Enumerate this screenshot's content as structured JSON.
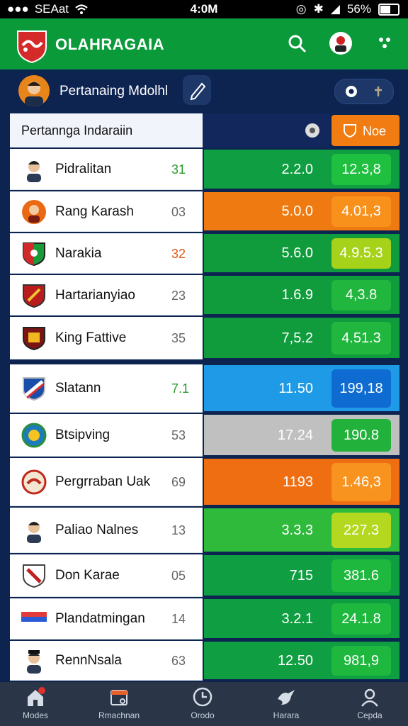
{
  "status": {
    "carrier": "SEAat",
    "time": "4:0M",
    "battery": "56%"
  },
  "app": {
    "title": "OLAHRAGAIA"
  },
  "subheader": {
    "title": "Pertanaing Mdolhl"
  },
  "table": {
    "header_label": "Pertannga Indaraiin",
    "header_button": "Noe",
    "rows": [
      {
        "name": "Pidralitan",
        "num": "31",
        "num_color": "#2a9a2a",
        "val": "2.2.0",
        "box": "12.3,8",
        "bar": "#0f9e41",
        "box_color": "#1fbf40",
        "badge": "face"
      },
      {
        "name": "Rang Karash",
        "num": "03",
        "num_color": "#666666",
        "val": "5.0.0",
        "box": "4.01,3",
        "bar": "#f07a12",
        "box_color": "#f8911c",
        "badge": "face-orange"
      },
      {
        "name": "Narakia",
        "num": "32",
        "num_color": "#e05a1a",
        "val": "5.6.0",
        "box": "4.9.5.3",
        "bar": "#109c3c",
        "box_color": "#a6d21a",
        "badge": "shield-green"
      },
      {
        "name": "Hartarianyiao",
        "num": "23",
        "num_color": "#666666",
        "val": "1.6.9",
        "box": "4,3.8",
        "bar": "#109c3c",
        "box_color": "#21b63d",
        "badge": "shield-red"
      },
      {
        "name": "King Fattive",
        "num": "35",
        "num_color": "#666666",
        "val": "7,5.2",
        "box": "4.51.3",
        "bar": "#109c3c",
        "box_color": "#21b63d",
        "badge": "shield-dark"
      },
      {
        "name": "Slatann",
        "num": "7.1",
        "num_color": "#2a9a2a",
        "val": "11.50",
        "box": "199,18",
        "bar": "#1e9ae6",
        "box_color": "#0d6bd2",
        "badge": "shield-blue"
      },
      {
        "name": "Btsipving",
        "num": "53",
        "num_color": "#666666",
        "val": "17.24",
        "box": "190.8",
        "bar": "#c0c0c0",
        "box_color": "#22b23c",
        "badge": "round-green"
      },
      {
        "name": "Pergrraban Uak",
        "num": "69",
        "num_color": "#666666",
        "val": "1193",
        "box": "1.46,3",
        "bar": "#ef6e12",
        "box_color": "#f7931e",
        "badge": "round-red"
      },
      {
        "name": "Paliao Nalnes",
        "num": "13",
        "num_color": "#666666",
        "val": "3.3.3",
        "box": "227.3",
        "bar": "#2fba3c",
        "box_color": "#b4d820",
        "badge": "face"
      },
      {
        "name": "Don Karae",
        "num": "05",
        "num_color": "#666666",
        "val": "715",
        "box": "381.6",
        "bar": "#0f9e41",
        "box_color": "#1fb83e",
        "badge": "shield-white"
      },
      {
        "name": "Plandatmingan",
        "num": "14",
        "num_color": "#666666",
        "val": "3.2.1",
        "box": "24.1.8",
        "bar": "#0f9e41",
        "box_color": "#1fb83e",
        "badge": "flag"
      },
      {
        "name": "RennNsala",
        "num": "63",
        "num_color": "#666666",
        "val": "12.50",
        "box": "981,9",
        "bar": "#0f9e41",
        "box_color": "#1fb83e",
        "badge": "face-cap"
      }
    ]
  },
  "nav": [
    {
      "label": "Modes",
      "icon": "home-icon"
    },
    {
      "label": "Rmachnan",
      "icon": "calendar-icon"
    },
    {
      "label": "Orodo",
      "icon": "clock-icon"
    },
    {
      "label": "Harara",
      "icon": "bird-icon"
    },
    {
      "label": "Cepda",
      "icon": "profile-icon"
    }
  ]
}
